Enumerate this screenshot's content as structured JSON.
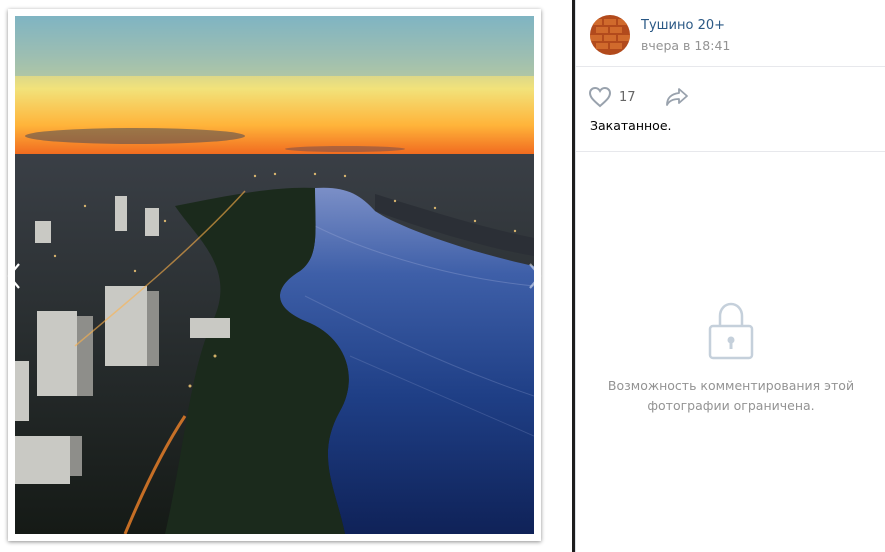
{
  "viewer": {
    "photo_description": "Aerial sunset view over a river with high-rise buildings"
  },
  "post": {
    "author": "Тушино 20+",
    "time": "вчера в 18:41",
    "likes": "17",
    "caption": "Закатанное.",
    "comments_closed_line1": "Возможность комментирования этой",
    "comments_closed_line2": "фотографии ограничена."
  },
  "icons": {
    "prev": "chevron-left-icon",
    "next": "chevron-right-icon",
    "like": "heart-outline-icon",
    "share": "share-arrow-icon",
    "lock": "lock-icon"
  },
  "colors": {
    "link": "#2a5885",
    "muted": "#939393",
    "icon": "#99a2ad"
  }
}
